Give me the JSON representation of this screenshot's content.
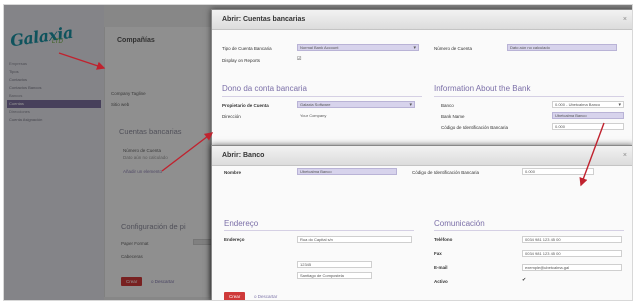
{
  "sidebar": {
    "logo": "Galaxia",
    "logo_sub": "LTD",
    "items": [
      {
        "label": "Empresas",
        "active": false
      },
      {
        "label": "Tipos",
        "active": false
      },
      {
        "label": "Contactos",
        "active": false
      },
      {
        "label": "Contactos Bancos",
        "active": false
      },
      {
        "label": "Bancos",
        "active": false
      },
      {
        "label": "Cuentas",
        "active": true
      },
      {
        "label": "Direcciones",
        "active": false
      },
      {
        "label": "Cuenta Asignación",
        "active": false
      }
    ]
  },
  "background": {
    "title": "Compañías",
    "company_tagline_label": "Company Tagline",
    "website_label": "Sitio web",
    "bank_section": "Cuentas bancarias",
    "account_number_label": "Número de Cuenta",
    "account_number_value": "Dato aún no calculado",
    "add_item": "Añadir un elemento",
    "config_section": "Configuración de pi",
    "paper_format_label": "Paper Format",
    "layout_label": "Cabeceras",
    "create_label": "Crear",
    "discard_label": "o Descartar"
  },
  "dialog_account": {
    "title": "Abrir: Cuentas bancarias",
    "account_type_label": "Tipo de Cuenta Bancaria",
    "account_type_value": "Normal Bank Account",
    "account_number_label": "Número de Cuenta",
    "account_number_value": "Dato aún no calculado",
    "display_on_reports_label": "Display on Reports",
    "display_on_reports_value": "☑",
    "owner_section": "Dono da conta bancaria",
    "owner_label": "Propietario de Cuenta",
    "owner_value": "Galaxia Software",
    "address_label": "Dirección",
    "address_value": "Your Company",
    "bank_info_section": "Information About the Bank",
    "bank_label": "Banco",
    "bank_value": "0.000 - Ubetcalma Banco",
    "bank_name_label": "Bank Name",
    "bank_name_value": "Ubetcalma Banco",
    "bic_label": "Código de Identificación Bancaria",
    "bic_value": "0.000"
  },
  "dialog_bank": {
    "title": "Abrir: Banco",
    "name_label": "Nombre",
    "name_value": "Ubetcalma Banco",
    "bic_label": "Código de Identificación Bancaria",
    "bic_value": "0.000",
    "address_section": "Endereço",
    "address_label": "Endereço",
    "street_value": "Rua do Capital s/n",
    "zip_value": "12345",
    "city_value": "Santiago de Compostela",
    "contact_section": "Comunicación",
    "phone_label": "Teléfono",
    "phone_value": "0034 981 123 45 00",
    "fax_label": "Fax",
    "fax_value": "0034 981 123 45 00",
    "email_label": "E-mail",
    "email_value": "exemple@ubetcalma.gal",
    "active_label": "Activo",
    "active_value": "✔",
    "create_label": "Crear",
    "discard_label": "o Descartar"
  },
  "colors": {
    "accent": "#7b6fa8",
    "required_field": "#d7d3ec",
    "create_button": "#cf3a3a",
    "arrow": "#c0222e"
  }
}
